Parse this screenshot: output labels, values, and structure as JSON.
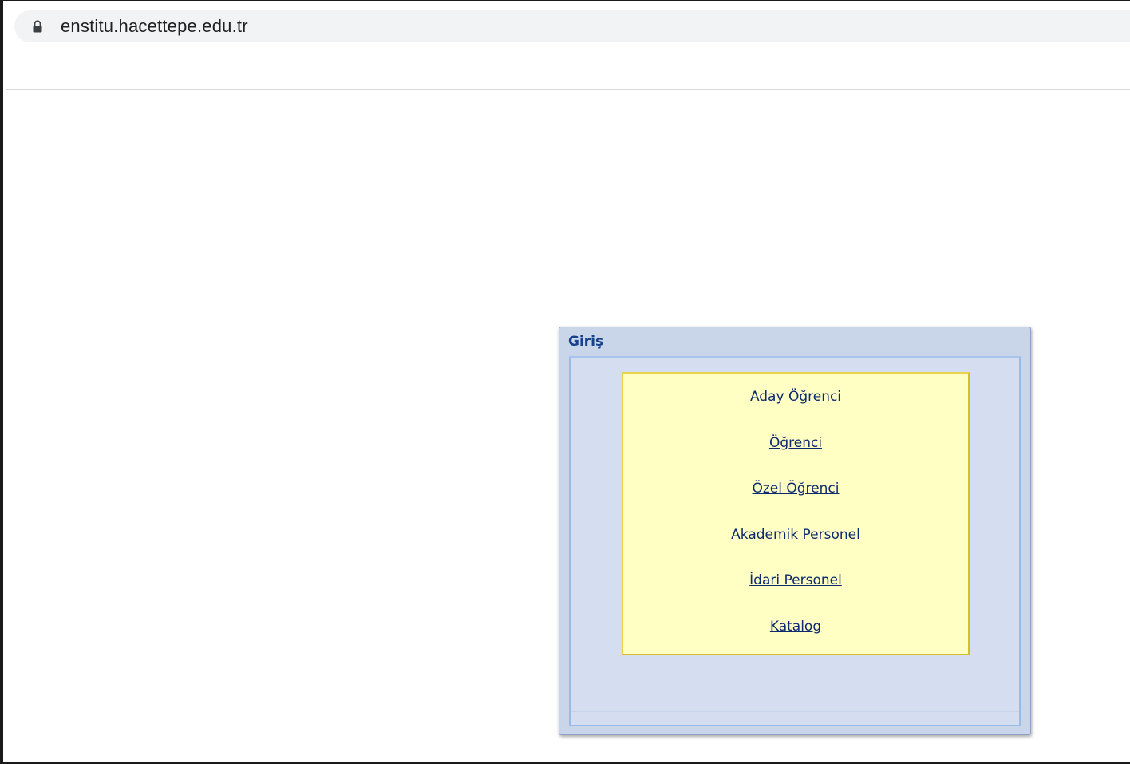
{
  "browser": {
    "url": "enstitu.hacettepe.edu.tr",
    "lock_icon": "lock-icon"
  },
  "login_panel": {
    "title": "Giriş",
    "links": [
      "Aday Öğrenci",
      "Öğrenci",
      "Özel Öğrenci",
      "Akademik Personel",
      "İdari Personel",
      "Katalog"
    ]
  },
  "colors": {
    "panel_title": "#15428b",
    "panel_background": "#c9d6ea",
    "links_background": "#ffffc4",
    "links_border": "#e8d24a",
    "link_text": "#0d2a6e"
  }
}
